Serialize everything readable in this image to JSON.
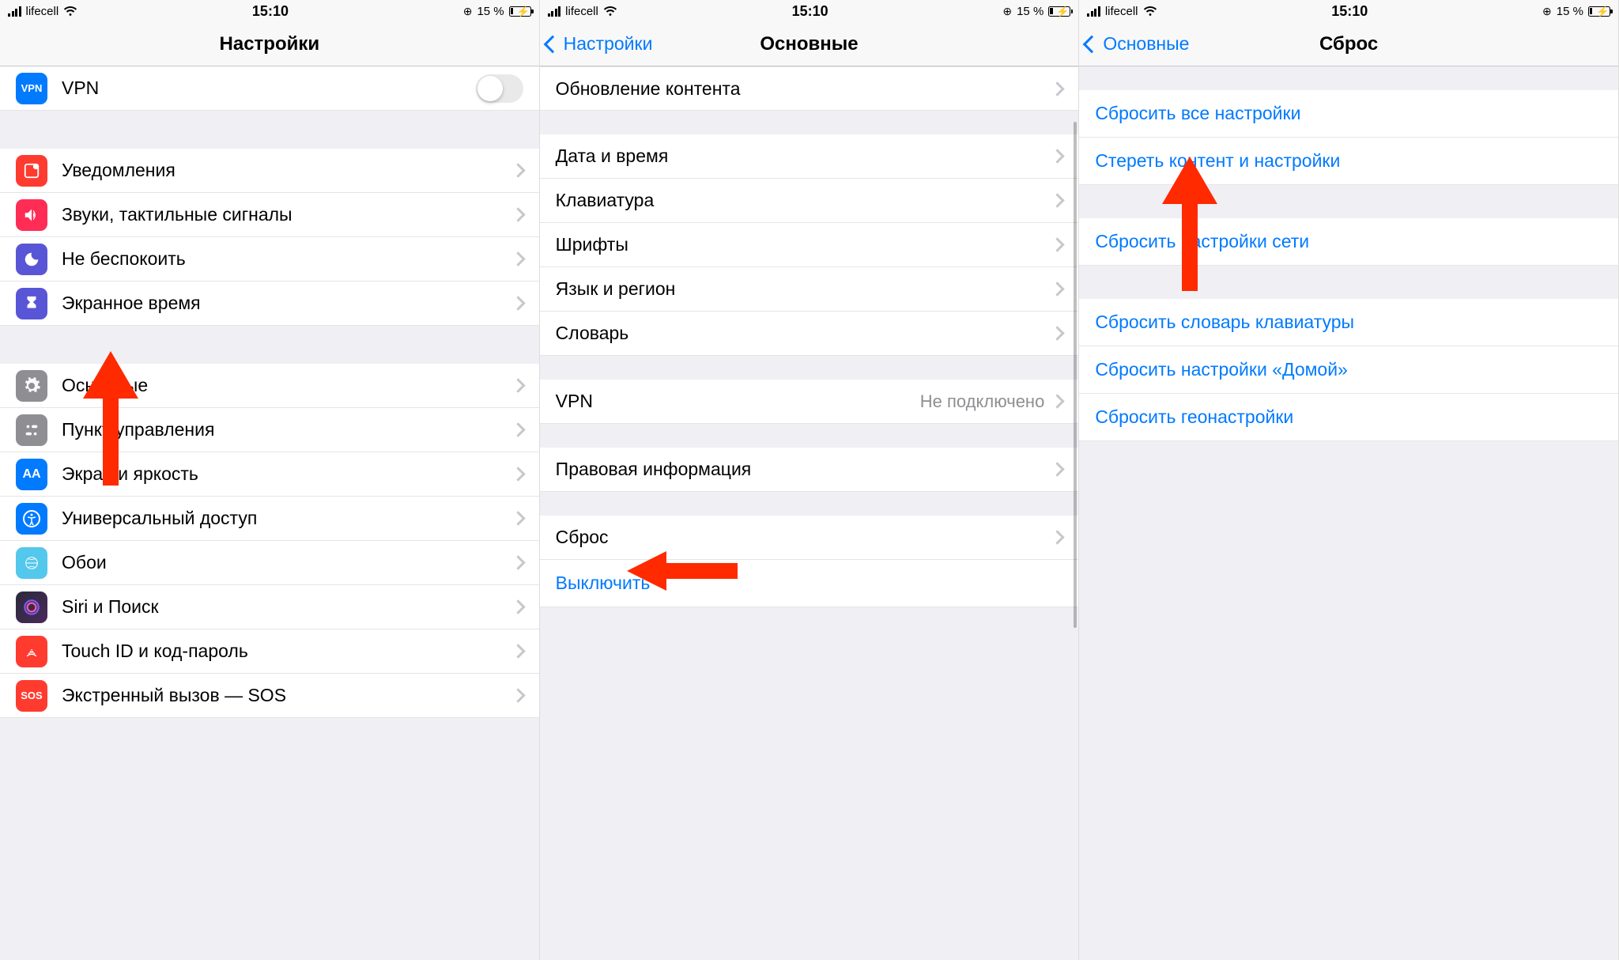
{
  "status": {
    "carrier": "lifecell",
    "time": "15:10",
    "battery_pct": "15 %",
    "ring_glyph": "⊕"
  },
  "panes": {
    "p1": {
      "nav_title": "Настройки",
      "rows": {
        "vpn": "VPN",
        "notifications": "Уведомления",
        "sounds": "Звуки, тактильные сигналы",
        "dnd": "Не беспокоить",
        "screentime": "Экранное время",
        "general": "Основные",
        "control_center": "Пункт управления",
        "display": "Экран и яркость",
        "accessibility": "Универсальный доступ",
        "wallpaper": "Обои",
        "siri": "Siri и Поиск",
        "touchid": "Touch ID и код-пароль",
        "sos": "Экстренный вызов — SOS"
      }
    },
    "p2": {
      "nav_back": "Настройки",
      "nav_title": "Основные",
      "rows": {
        "content_update": "Обновление контента",
        "date_time": "Дата и время",
        "keyboard": "Клавиатура",
        "fonts": "Шрифты",
        "language": "Язык и регион",
        "dictionary": "Словарь",
        "vpn_label": "VPN",
        "vpn_value": "Не подключено",
        "legal": "Правовая информация",
        "reset": "Сброс",
        "shutdown": "Выключить"
      }
    },
    "p3": {
      "nav_back": "Основные",
      "nav_title": "Сброс",
      "rows": {
        "reset_all": "Сбросить все настройки",
        "erase_all": "Стереть контент и настройки",
        "reset_network": "Сбросить настройки сети",
        "reset_keyboard": "Сбросить словарь клавиатуры",
        "reset_home": "Сбросить настройки «Домой»",
        "reset_location": "Сбросить геонастройки"
      }
    }
  },
  "icon_colors": {
    "vpn": "#007aff",
    "notifications": "#ff3b30",
    "sounds": "#ff2d55",
    "dnd": "#5856d6",
    "screentime": "#5856d6",
    "general": "#8e8e93",
    "control_center": "#8e8e93",
    "display": "#007aff",
    "accessibility": "#007aff",
    "wallpaper": "#54c7ec",
    "siri": "#1c1c1e",
    "touchid": "#ff3b30",
    "sos": "#ff3b30"
  },
  "icon_glyphs": {
    "vpn": "VPN",
    "sos": "SOS",
    "display": "AA"
  }
}
